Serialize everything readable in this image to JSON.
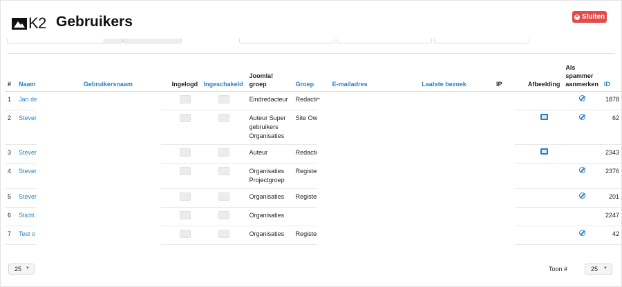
{
  "header": {
    "logo_text": "K2",
    "title": "Gebruikers",
    "close_label": "Sluiten"
  },
  "table": {
    "columns": {
      "num": "#",
      "name": "Naam",
      "username": "Gebruikersnaam",
      "loggedin": "Ingelogd",
      "enabled": "Ingeschakeld",
      "joomla_group": "Joomla! groep",
      "group": "Groep",
      "email": "E-mailadres",
      "last_visit": "Laatste bezoek",
      "ip": "IP",
      "image": "Afbeelding",
      "spammer": "Als spammer aanmerken",
      "id": "ID"
    },
    "rows": [
      {
        "num": "1",
        "name": "Jan de Redac",
        "joomla_group": "Eindredacteur",
        "group": "Redactie",
        "image": false,
        "spam": true,
        "id": "1878"
      },
      {
        "num": "2",
        "name": "Steven",
        "joomla_group": "Auteur Super gebruikers Organisaties",
        "group": "Site Owner",
        "image": true,
        "spam": true,
        "id": "62"
      },
      {
        "num": "3",
        "name": "Steven",
        "joomla_group": "Auteur",
        "group": "Redactie",
        "image": true,
        "spam": false,
        "id": "2343"
      },
      {
        "num": "4",
        "name": "Steven",
        "joomla_group": "Organisaties Projectgroep",
        "group": "Registered",
        "image": false,
        "spam": true,
        "id": "2376"
      },
      {
        "num": "5",
        "name": "Steven",
        "joomla_group": "Organisaties",
        "group": "Registered",
        "image": false,
        "spam": true,
        "id": "201"
      },
      {
        "num": "6",
        "name": "Sticht Steven",
        "joomla_group": "Organisaties",
        "group": "",
        "image": false,
        "spam": false,
        "id": "2247"
      },
      {
        "num": "7",
        "name": "Test o",
        "joomla_group": "Organisaties",
        "group": "Registered",
        "image": false,
        "spam": true,
        "id": "42"
      }
    ]
  },
  "footer": {
    "limit_left": "25",
    "show_label": "Toon #",
    "limit_right": "25"
  }
}
